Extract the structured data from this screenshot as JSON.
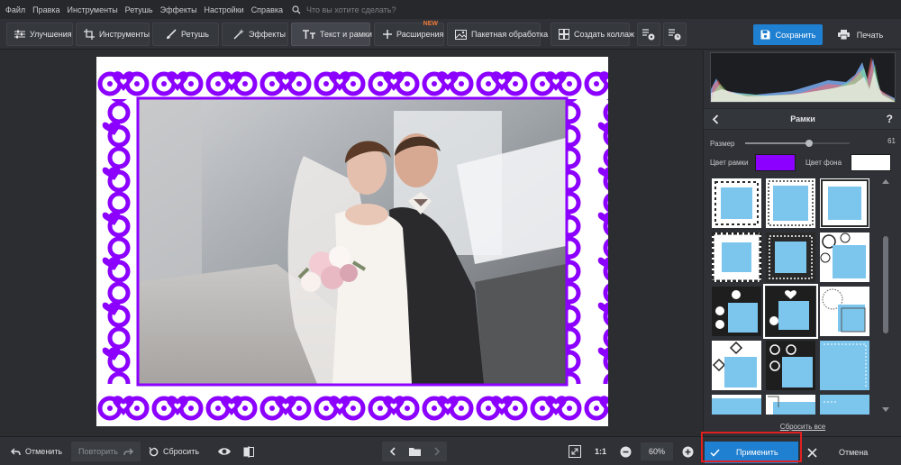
{
  "menu": [
    "Файл",
    "Правка",
    "Инструменты",
    "Ретушь",
    "Эффекты",
    "Настройки",
    "Справка"
  ],
  "search": {
    "placeholder": "Что вы хотите сделать?"
  },
  "toolbar": {
    "tabs": [
      {
        "label": "Улучшения",
        "icon": "sliders-icon"
      },
      {
        "label": "Инструменты",
        "icon": "crop-icon"
      },
      {
        "label": "Ретушь",
        "icon": "brush-icon"
      },
      {
        "label": "Эффекты",
        "icon": "magic-wand-icon"
      },
      {
        "label": "Текст и рамки",
        "icon": "text-icon",
        "active": true
      },
      {
        "label": "Расширения",
        "icon": "plus-icon",
        "badge": "NEW"
      },
      {
        "label": "Пакетная обработка",
        "icon": "images-icon"
      },
      {
        "label": "Создать коллаж",
        "icon": "collage-icon"
      }
    ],
    "save_label": "Сохранить",
    "print_label": "Печать"
  },
  "panel": {
    "title": "Рамки",
    "help": "?",
    "size_label": "Размер",
    "size_value": "61",
    "size_fraction": 0.61,
    "frame_color_label": "Цвет рамки",
    "frame_color": "#8b00ff",
    "bg_color_label": "Цвет фона",
    "bg_color": "#ffffff",
    "reset_all": "Сбросить все"
  },
  "bottom": {
    "undo_label": "Отменить",
    "redo_label": "Повторить",
    "reset_label": "Сбросить",
    "ratio_label": "1:1",
    "zoom_value": "60%",
    "apply_label": "Применить",
    "cancel_label": "Отмена"
  },
  "colors": {
    "accent": "#1f7fd0",
    "frame_purple": "#8b00ff",
    "highlight": "#e02020",
    "thumb_photo": "#7cc6ee"
  }
}
